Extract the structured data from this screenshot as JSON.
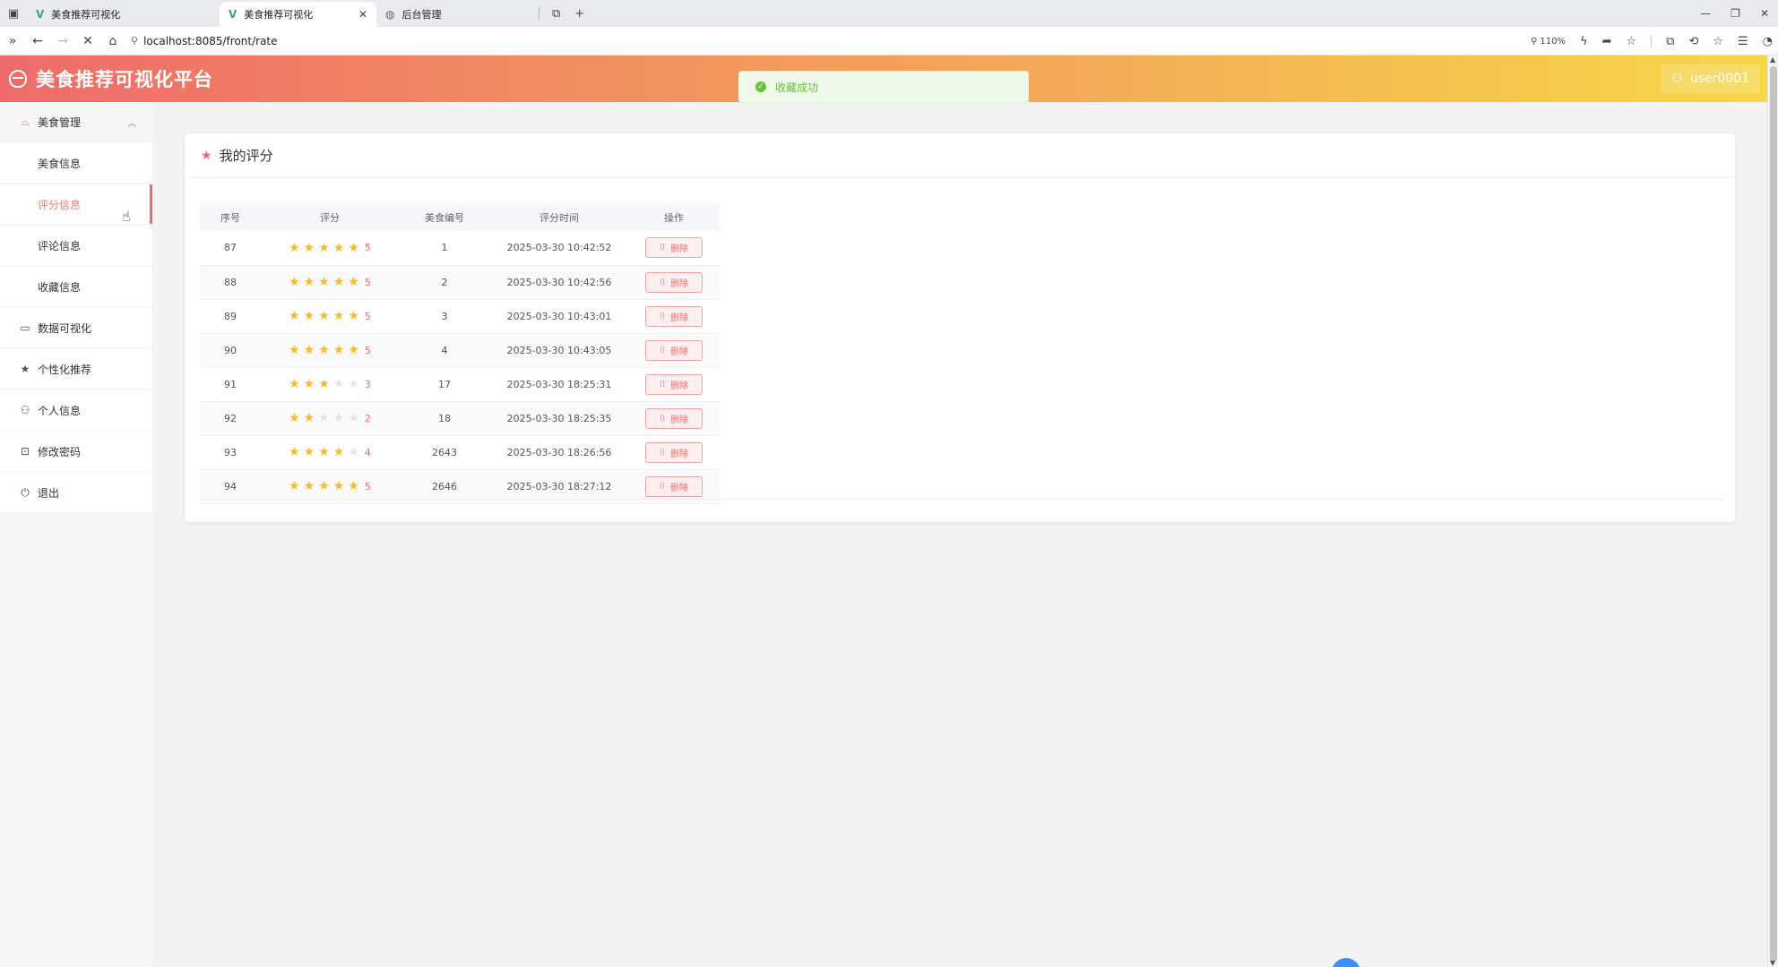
{
  "browser": {
    "tabs": [
      {
        "title": "美食推荐可视化",
        "active": false
      },
      {
        "title": "美食推荐可视化",
        "active": true
      },
      {
        "title": "后台管理",
        "active": false
      }
    ],
    "url": "localhost:8085/front/rate",
    "zoom": "110%"
  },
  "header": {
    "title": "美食推荐可视化平台",
    "username": "user0001",
    "gradient": [
      "#ef6b6b",
      "#f4a55a",
      "#f6d748"
    ]
  },
  "toast": {
    "message": "收藏成功",
    "color": "#67c23a"
  },
  "sidebar": {
    "group": {
      "label": "美食管理",
      "icon": "bowl-icon",
      "expanded": true
    },
    "sub_items": [
      {
        "label": "美食信息",
        "active": false
      },
      {
        "label": "评分信息",
        "active": true
      },
      {
        "label": "评论信息",
        "active": false
      },
      {
        "label": "收藏信息",
        "active": false
      }
    ],
    "items": [
      {
        "label": "数据可视化",
        "icon": "chart-icon"
      },
      {
        "label": "个性化推荐",
        "icon": "star-icon"
      },
      {
        "label": "个人信息",
        "icon": "user-icon"
      },
      {
        "label": "修改密码",
        "icon": "lock-icon"
      },
      {
        "label": "退出",
        "icon": "power-icon"
      }
    ]
  },
  "main": {
    "card_title": "我的评分",
    "columns": [
      "序号",
      "评分",
      "美食编号",
      "评分时间",
      "操作"
    ],
    "delete_label": "删除",
    "rows": [
      {
        "seq": "87",
        "rating": 5,
        "food_id": "1",
        "time": "2025-03-30 10:42:52"
      },
      {
        "seq": "88",
        "rating": 5,
        "food_id": "2",
        "time": "2025-03-30 10:42:56"
      },
      {
        "seq": "89",
        "rating": 5,
        "food_id": "3",
        "time": "2025-03-30 10:43:01"
      },
      {
        "seq": "90",
        "rating": 5,
        "food_id": "4",
        "time": "2025-03-30 10:43:05"
      },
      {
        "seq": "91",
        "rating": 3,
        "food_id": "17",
        "time": "2025-03-30 18:25:31"
      },
      {
        "seq": "92",
        "rating": 2,
        "food_id": "18",
        "time": "2025-03-30 18:25:35"
      },
      {
        "seq": "93",
        "rating": 4,
        "food_id": "2643",
        "time": "2025-03-30 18:26:56"
      },
      {
        "seq": "94",
        "rating": 5,
        "food_id": "2646",
        "time": "2025-03-30 18:27:12"
      }
    ]
  },
  "colors": {
    "accent": "#ef6b6b",
    "star": "#f7ba2a",
    "danger": "#f56c6c"
  }
}
